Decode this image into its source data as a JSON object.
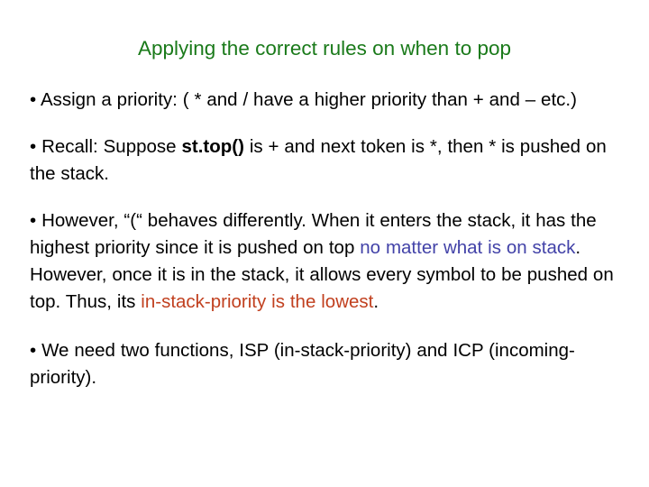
{
  "slide": {
    "title": "Applying the correct rules on when to pop",
    "title_color": "#1a7a1a",
    "background_color": "#ffffff",
    "bullet_glyph": "•",
    "bullets": [
      {
        "name": "bullet-assign-priority",
        "runs": [
          {
            "text": "• Assign a priority: ( * and / have a higher priority than + and – etc.)",
            "color": "#000000",
            "bold": false
          }
        ]
      },
      {
        "name": "bullet-recall",
        "runs": [
          {
            "text": "• Recall: Suppose ",
            "color": "#000000",
            "bold": false
          },
          {
            "text": "st.top()",
            "color": "#000000",
            "bold": true
          },
          {
            "text": " is + and next token is *, then * is pushed on the stack.",
            "color": "#000000",
            "bold": false
          }
        ]
      },
      {
        "name": "bullet-however-paren",
        "runs": [
          {
            "text": "• However, “(“ behaves differently. When it enters the stack, it has the highest priority since it is pushed on top ",
            "color": "#000000",
            "bold": false
          },
          {
            "text": "no matter what is on stack",
            "color": "#4242a8",
            "bold": false
          },
          {
            "text": ". However, once it is in the stack, it allows every symbol to be pushed on top. Thus, its ",
            "color": "#000000",
            "bold": false
          },
          {
            "text": "in-stack-priority is the lowest",
            "color": "#c1401f",
            "bold": false
          },
          {
            "text": ".",
            "color": "#000000",
            "bold": false
          }
        ]
      },
      {
        "name": "bullet-two-functions",
        "runs": [
          {
            "text": "• We need two functions, ISP (in-stack-priority) and ICP (incoming-priority).",
            "color": "#000000",
            "bold": false
          }
        ]
      }
    ]
  }
}
